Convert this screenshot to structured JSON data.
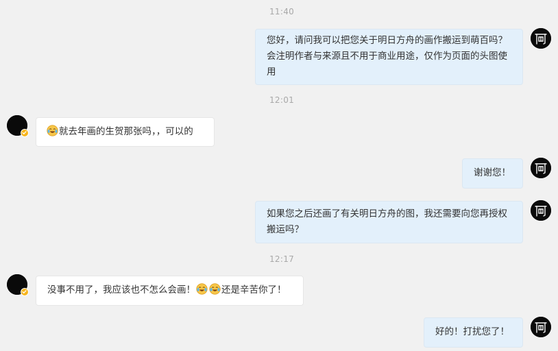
{
  "timestamps": [
    "11:40",
    "12:01",
    "12:17"
  ],
  "messages": [
    {
      "direction": "out",
      "text": "您好，请问我可以把您关于明日方舟的画作搬运到萌百吗？会注明作者与来源且不用于商业用途，仅作为页面的头图使用"
    },
    {
      "direction": "in",
      "text": "就去年画的生贺那张吗，，可以的"
    },
    {
      "direction": "out",
      "text": "谢谢您！"
    },
    {
      "direction": "out",
      "text": "如果您之后还画了有关明日方舟的图，我还需要向您再授权搬运吗？"
    },
    {
      "direction": "in",
      "text_a": "没事不用了，我应该也不怎么会画！",
      "text_b": "还是辛苦你了！"
    },
    {
      "direction": "out",
      "text": "好的！打扰您了！"
    }
  ],
  "icons": {
    "self_avatar": "calligraphy-avatar-icon",
    "contact_avatar": "black-avatar-icon",
    "verified_badge": "verified-badge-icon",
    "emoji": "laugh-cry-emoji-icon"
  },
  "colors": {
    "background": "#f1f1f1",
    "outgoing_bubble": "#e3f0fb",
    "incoming_bubble": "#ffffff",
    "badge": "#f7b51d",
    "timestamp": "#a8a8a8"
  }
}
